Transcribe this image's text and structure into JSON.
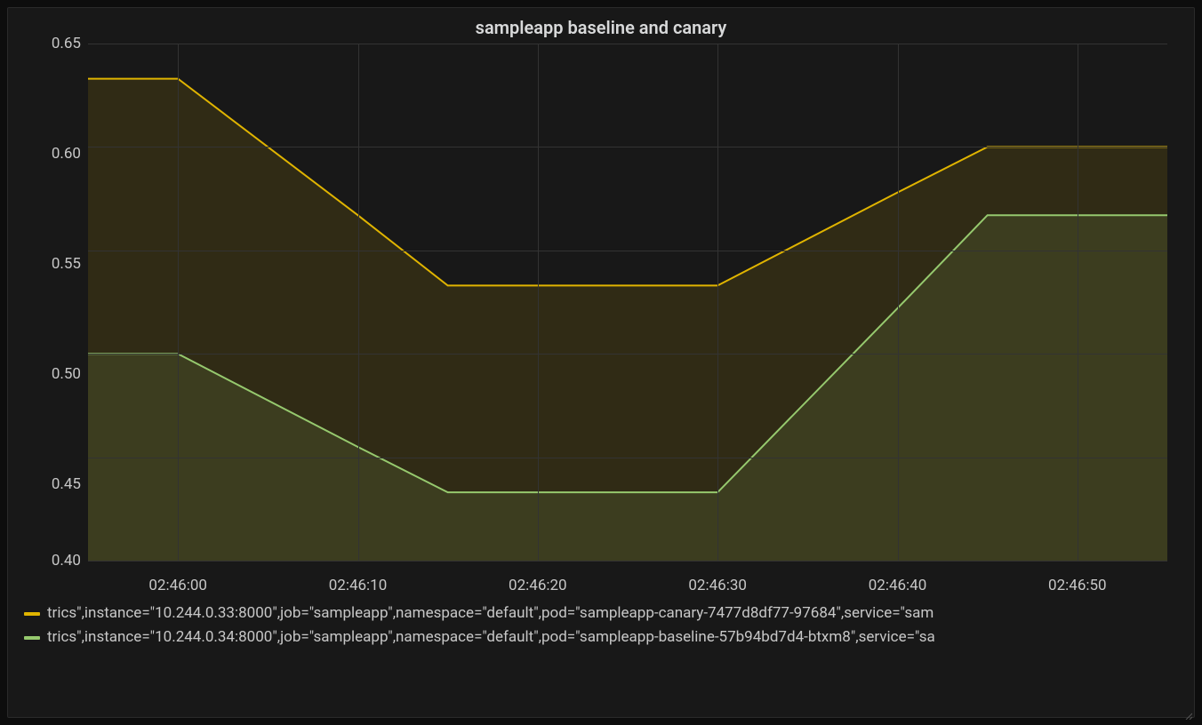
{
  "panel": {
    "title": "sampleapp baseline and canary"
  },
  "chart_data": {
    "type": "area",
    "x": [
      "02:45:55",
      "02:46:00",
      "02:46:10",
      "02:46:15",
      "02:46:20",
      "02:46:30",
      "02:46:40",
      "02:46:45",
      "02:46:50",
      "02:46:55"
    ],
    "x_seconds": [
      -5,
      0,
      10,
      15,
      20,
      30,
      40,
      45,
      50,
      55
    ],
    "series": [
      {
        "name": "canary",
        "color": "#e0b400",
        "values": [
          0.633,
          0.633,
          0.567,
          0.533,
          0.533,
          0.533,
          0.578,
          0.6,
          0.6,
          0.6
        ]
      },
      {
        "name": "baseline",
        "color": "#96c96e",
        "values": [
          0.5,
          0.5,
          0.455,
          0.433,
          0.433,
          0.433,
          0.522,
          0.567,
          0.567,
          0.567
        ]
      }
    ],
    "ylim": [
      0.4,
      0.65
    ],
    "y_ticks": [
      0.4,
      0.45,
      0.5,
      0.55,
      0.6,
      0.65
    ],
    "x_ticks": [
      "02:46:00",
      "02:46:10",
      "02:46:20",
      "02:46:30",
      "02:46:40",
      "02:46:50"
    ],
    "x_tick_seconds": [
      0,
      10,
      20,
      30,
      40,
      50
    ]
  },
  "axis": {
    "y_ticks_labels": [
      "0.40",
      "0.45",
      "0.50",
      "0.55",
      "0.60",
      "0.65"
    ],
    "x_ticks_labels": [
      "02:46:00",
      "02:46:10",
      "02:46:20",
      "02:46:30",
      "02:46:40",
      "02:46:50"
    ]
  },
  "legend": {
    "items": [
      {
        "color": "#e0b400",
        "label": "trics\",instance=\"10.244.0.33:8000\",job=\"sampleapp\",namespace=\"default\",pod=\"sampleapp-canary-7477d8df77-97684\",service=\"sam"
      },
      {
        "color": "#96c96e",
        "label": "trics\",instance=\"10.244.0.34:8000\",job=\"sampleapp\",namespace=\"default\",pod=\"sampleapp-baseline-57b94bd7d4-btxm8\",service=\"sa"
      }
    ]
  }
}
